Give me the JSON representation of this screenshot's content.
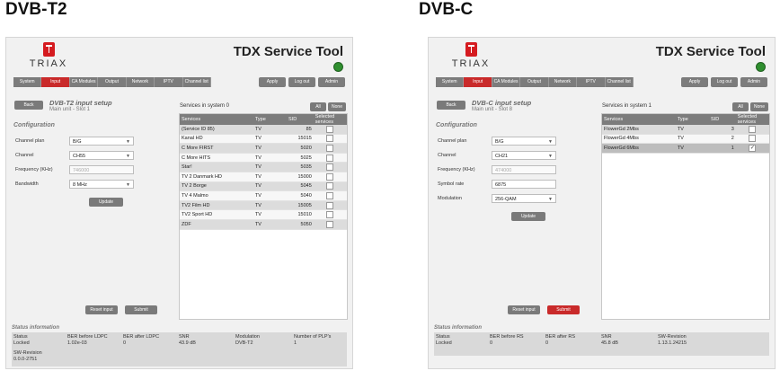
{
  "captions": {
    "left": "DVB-T2",
    "right": "DVB-C"
  },
  "app": {
    "logo_text": "TRIAX",
    "title": "TDX Service Tool"
  },
  "nav": {
    "tabs": [
      "System",
      "Input",
      "CA Modules",
      "Output",
      "Network",
      "IPTV",
      "Channel list"
    ],
    "active": "Input",
    "right_tabs": [
      "Apply",
      "Log out",
      "Admin"
    ]
  },
  "left": {
    "back": "Back",
    "heading": "DVB-T2 input setup",
    "subheading": "Main unit - Slot 1",
    "config": "Configuration",
    "fields": [
      {
        "label": "Channel plan",
        "value": "B/G",
        "dropdown": true
      },
      {
        "label": "Channel",
        "value": "CH55",
        "dropdown": true
      },
      {
        "label": "Frequency (KHz)",
        "value": "746000",
        "disabled": true
      },
      {
        "label": "Bandwidth",
        "value": "8 MHz",
        "dropdown": true
      }
    ],
    "update": "Update",
    "services_label": "Services in system 0",
    "btns": [
      "All",
      "None"
    ],
    "columns": [
      "Services",
      "Type",
      "SID",
      "Selected services"
    ],
    "rows": [
      [
        "(Service ID 85)",
        "TV",
        "85"
      ],
      [
        "Kanal HD",
        "TV",
        "15015"
      ],
      [
        "C More FIRST",
        "TV",
        "5020"
      ],
      [
        "C More HITS",
        "TV",
        "5025"
      ],
      [
        "Star!",
        "TV",
        "5035"
      ],
      [
        "TV 2 Danmark HD",
        "TV",
        "15000"
      ],
      [
        "TV 2 Borge",
        "TV",
        "5045"
      ],
      [
        "TV 4 Malmo",
        "TV",
        "5040"
      ],
      [
        "TV2 Film HD",
        "TV",
        "15005"
      ],
      [
        "TV2 Sport HD",
        "TV",
        "15010"
      ],
      [
        "ZDF",
        "TV",
        "5050"
      ]
    ],
    "reset": "Reset input",
    "submit": "Submit",
    "status_title": "Status information",
    "status": [
      [
        "Status",
        "Locked"
      ],
      [
        "BER before LDPC",
        "1.02e-03"
      ],
      [
        "BER after LDPC",
        "0"
      ],
      [
        "SNR",
        "43.9 dB"
      ],
      [
        "Modulation",
        "DVB-T2"
      ],
      [
        "Number of PLP's",
        "1"
      ]
    ],
    "status2": [
      "SW-Revision",
      "0.0.0-2751"
    ]
  },
  "right": {
    "back": "Back",
    "heading": "DVB-C input setup",
    "subheading": "Main unit - Slot 8",
    "config": "Configuration",
    "fields": [
      {
        "label": "Channel plan",
        "value": "B/G",
        "dropdown": true
      },
      {
        "label": "Channel",
        "value": "CH21",
        "dropdown": true
      },
      {
        "label": "Frequency (KHz)",
        "value": "474000",
        "disabled": true
      },
      {
        "label": "Symbol rate",
        "value": "6875"
      },
      {
        "label": "Modulation",
        "value": "256-QAM",
        "dropdown": true
      }
    ],
    "update": "Update",
    "services_label": "Services in system 1",
    "btns": [
      "All",
      "None"
    ],
    "columns": [
      "Services",
      "Type",
      "SID",
      "Selected services"
    ],
    "rows": [
      [
        "FlowerGd 2Mbs",
        "TV",
        "3"
      ],
      [
        "FlowerGd 4Mbs",
        "TV",
        "2"
      ],
      [
        "FlowerGd 6Mbs",
        "TV",
        "1"
      ]
    ],
    "selected_index": 2,
    "reset": "Reset input",
    "submit": "Submit",
    "status_title": "Status information",
    "status": [
      [
        "Status",
        "Locked"
      ],
      [
        "BER before RS",
        "0"
      ],
      [
        "BER after RS",
        "0"
      ],
      [
        "SNR",
        "45.8 dB"
      ],
      [
        "SW-Revision",
        "1.13.1.24215"
      ]
    ]
  }
}
